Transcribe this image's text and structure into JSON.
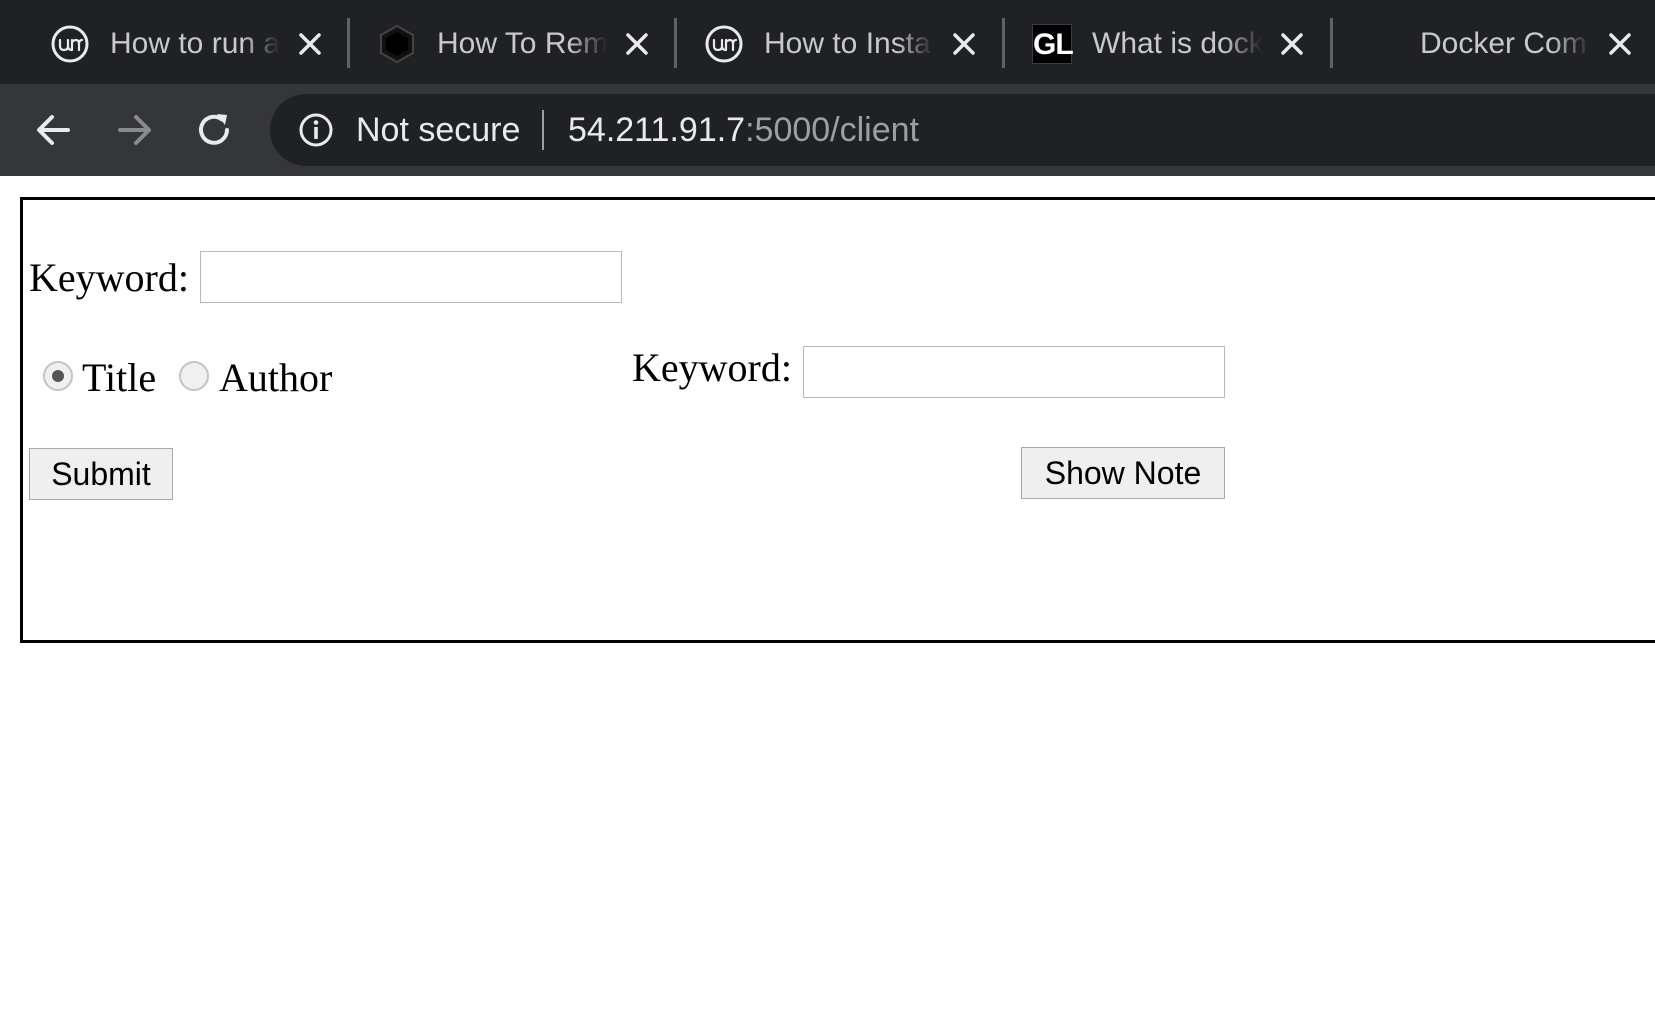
{
  "browser": {
    "tabs": [
      {
        "title": "How to run a",
        "favicon": "um-circle-icon"
      },
      {
        "title": "How To Rem",
        "favicon": "hexagon-icon"
      },
      {
        "title": "How to Insta",
        "favicon": "um-circle-icon"
      },
      {
        "title": "What is dock",
        "favicon": "gl-icon",
        "favicon_text": "GL"
      },
      {
        "title": "Docker Com",
        "favicon": "none"
      }
    ],
    "address_bar": {
      "security_text": "Not secure",
      "url_host": "54.211.91.7",
      "url_path": ":5000/client"
    }
  },
  "form": {
    "keyword_label_1": "Keyword:",
    "keyword_value_1": "",
    "radio_options": [
      {
        "label": "Title",
        "checked": true
      },
      {
        "label": "Author",
        "checked": false
      }
    ],
    "keyword_label_2": "Keyword:",
    "keyword_value_2": "",
    "submit_label": "Submit",
    "show_note_label": "Show Note"
  },
  "colors": {
    "tabstrip_bg": "#202124",
    "toolbar_bg": "#35363a",
    "omnibox_bg": "#202124",
    "url_host": "#e8eaed",
    "url_path": "#9aa0a6"
  }
}
